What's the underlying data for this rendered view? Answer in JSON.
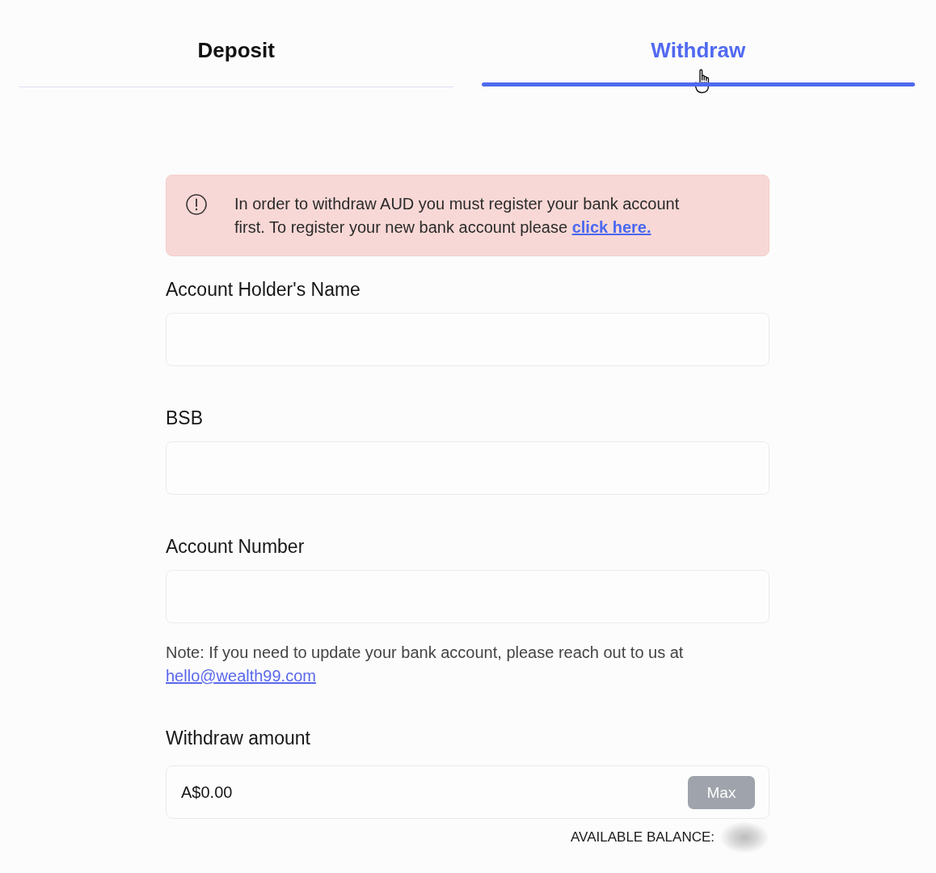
{
  "tabs": [
    {
      "label": "Deposit",
      "selected": false
    },
    {
      "label": "Withdraw",
      "selected": true
    }
  ],
  "alert": {
    "kind": "error",
    "text": "In order to withdraw AUD you must register your bank account first. To register your new bank account please ",
    "link": "click here."
  },
  "fields": [
    {
      "label": "Account Holder's Name"
    },
    {
      "label": "BSB"
    },
    {
      "label": "Account Number"
    }
  ],
  "note": {
    "text": "Note: If you need to update your bank account, please reach out to us at ",
    "link": "hello@wealth99.com"
  },
  "withdraw_amount": {
    "label": "Withdraw amount",
    "value": "A$0.00",
    "max_button": {
      "label": "Max",
      "disabled": true
    }
  },
  "available_balance": {
    "label": "AVAILABLE BALANCE:"
  }
}
